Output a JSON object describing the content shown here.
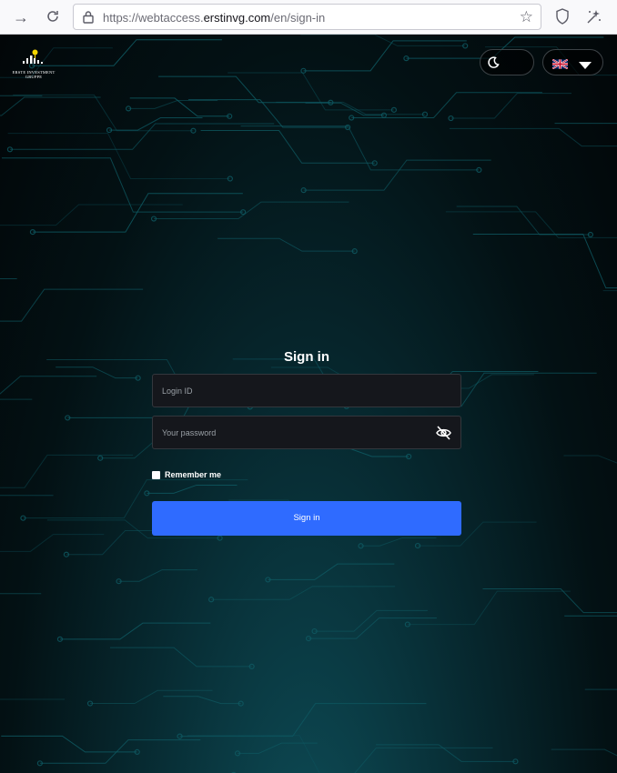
{
  "browser": {
    "url_prefix": "https://webtaccess.",
    "url_domain": "erstinvg.com",
    "url_path": "/en/sign-in"
  },
  "logo": {
    "line1": "ERSTE INVESTMENT",
    "line2": "GRUPPE"
  },
  "header": {
    "theme_icon": "moon-icon",
    "language_icon": "uk-flag-icon",
    "language_dropdown_icon": "caret-down-icon"
  },
  "form": {
    "title": "Sign in",
    "login_placeholder": "Login ID",
    "password_placeholder": "Your password",
    "remember_label": "Remember me",
    "submit_label": "Sign in"
  },
  "colors": {
    "accent": "#2f6bff",
    "background": "#031114",
    "circuit": "#0f5a63"
  }
}
